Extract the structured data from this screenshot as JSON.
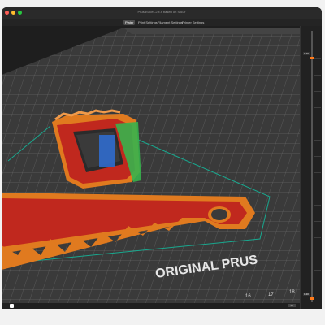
{
  "window": {
    "title": "PrusaSlicer-2.x.x based on Slic3r"
  },
  "tabs": [
    {
      "label": "Plater",
      "active": true
    },
    {
      "label": "Print Settings",
      "active": false
    },
    {
      "label": "Filament Settings",
      "active": false
    },
    {
      "label": "Printer Settings",
      "active": false
    }
  ],
  "bed": {
    "logo_text": "ORIGINAL PRUS",
    "axis_numbers": [
      "16",
      "17",
      "18"
    ]
  },
  "layer_slider": {
    "top_value": "0.20",
    "bottom_value": "0.20"
  },
  "horizontal_slider": {
    "end_value": "27"
  },
  "colors": {
    "perimeter": "#e07a1f",
    "infill": "#c0281e",
    "support": "#37b24d",
    "skirt": "#19a88f",
    "bed": "#3a3a3a",
    "accent": "#ff7a1a"
  },
  "icons": [
    "close-icon",
    "minimize-icon",
    "zoom-icon"
  ]
}
